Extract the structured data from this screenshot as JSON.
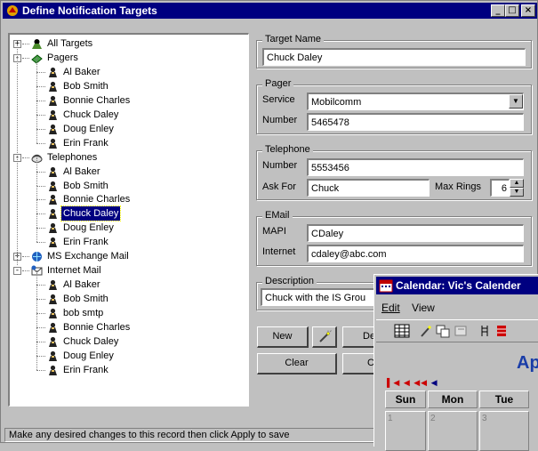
{
  "window": {
    "title": "Define Notification Targets"
  },
  "title_buttons": {
    "minimize": "_",
    "maximize": "□",
    "close": "×"
  },
  "tree": {
    "nodes": [
      {
        "label": "All Targets",
        "kind": "group",
        "expander": "+"
      },
      {
        "label": "Pagers",
        "kind": "group",
        "expander": "-"
      },
      {
        "label": "Al Baker",
        "kind": "person"
      },
      {
        "label": "Bob Smith",
        "kind": "person"
      },
      {
        "label": "Bonnie Charles",
        "kind": "person"
      },
      {
        "label": "Chuck Daley",
        "kind": "person"
      },
      {
        "label": "Doug Enley",
        "kind": "person"
      },
      {
        "label": "Erin Frank",
        "kind": "person"
      },
      {
        "label": "Telephones",
        "kind": "group",
        "expander": "-"
      },
      {
        "label": "Al Baker",
        "kind": "person"
      },
      {
        "label": "Bob Smith",
        "kind": "person"
      },
      {
        "label": "Bonnie Charles",
        "kind": "person"
      },
      {
        "label": "Chuck Daley",
        "kind": "person",
        "selected": true
      },
      {
        "label": "Doug Enley",
        "kind": "person"
      },
      {
        "label": "Erin Frank",
        "kind": "person"
      },
      {
        "label": "MS Exchange Mail",
        "kind": "group",
        "expander": "+"
      },
      {
        "label": "Internet Mail",
        "kind": "group",
        "expander": "-"
      },
      {
        "label": "Al Baker",
        "kind": "person"
      },
      {
        "label": "Bob Smith",
        "kind": "person"
      },
      {
        "label": "bob smtp",
        "kind": "person"
      },
      {
        "label": "Bonnie Charles",
        "kind": "person"
      },
      {
        "label": "Chuck Daley",
        "kind": "person"
      },
      {
        "label": "Doug Enley",
        "kind": "person"
      },
      {
        "label": "Erin Frank",
        "kind": "person"
      }
    ]
  },
  "target_name": {
    "group_label": "Target Name",
    "value": "Chuck Daley"
  },
  "pager": {
    "group_label": "Pager",
    "service_label": "Service",
    "service_value": "Mobilcomm",
    "number_label": "Number",
    "number_value": "5465478"
  },
  "telephone": {
    "group_label": "Telephone",
    "number_label": "Number",
    "number_value": "5553456",
    "ask_for_label": "Ask For",
    "ask_for_value": "Chuck",
    "max_rings_label": "Max Rings",
    "max_rings_value": "6"
  },
  "email": {
    "group_label": "EMail",
    "mapi_label": "MAPI",
    "mapi_value": "CDaley",
    "internet_label": "Internet",
    "internet_value": "cdaley@abc.com"
  },
  "description": {
    "group_label": "Description",
    "value": "Chuck with the IS Grou"
  },
  "buttons": {
    "new": "New",
    "delete_partial": "De",
    "clear": "Clear",
    "c_partial": "C"
  },
  "status": {
    "text": "Make any desired changes to this record then click Apply to save"
  },
  "calendar": {
    "title": "Calendar: Vic's Calender",
    "menu": [
      "Edit",
      "View"
    ],
    "month": "Apr",
    "days": [
      "Sun",
      "Mon",
      "Tue"
    ],
    "dates": [
      "1",
      "2",
      "3"
    ]
  },
  "colors": {
    "title_bar": "#000080",
    "selection": "#000080",
    "month_text": "#1a3da8",
    "nav_arrows": "#cc0000"
  }
}
